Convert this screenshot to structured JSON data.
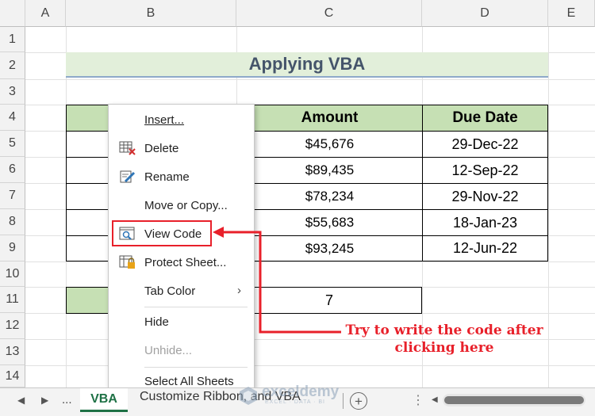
{
  "columns": [
    "A",
    "B",
    "C",
    "D",
    "E"
  ],
  "rows": [
    "1",
    "2",
    "3",
    "4",
    "5",
    "6",
    "7",
    "8",
    "9",
    "10",
    "11",
    "12",
    "13",
    "14"
  ],
  "title": "Applying VBA",
  "table": {
    "headers": [
      "",
      "Amount",
      "Due Date"
    ],
    "amounts": [
      "$45,676",
      "$89,435",
      "$78,234",
      "$55,683",
      "$93,245"
    ],
    "due_dates": [
      "29-Dec-22",
      "12-Sep-22",
      "29-Nov-22",
      "18-Jan-23",
      "12-Jun-22"
    ]
  },
  "count_value": "7",
  "context_menu": {
    "items": [
      {
        "label": "Insert...",
        "icon": "none"
      },
      {
        "label": "Delete",
        "icon": "delete-sheet-icon"
      },
      {
        "label": "Rename",
        "icon": "rename-icon"
      },
      {
        "label": "Move or Copy...",
        "icon": "none"
      },
      {
        "label": "View Code",
        "icon": "view-code-icon"
      },
      {
        "label": "Protect Sheet...",
        "icon": "protect-sheet-icon"
      },
      {
        "label": "Tab Color",
        "icon": "none"
      },
      {
        "label": "Hide",
        "icon": "none"
      },
      {
        "label": "Unhide...",
        "icon": "none",
        "disabled": true
      },
      {
        "label": "Select All Sheets",
        "icon": "none"
      }
    ]
  },
  "annotation": {
    "line1": "Try to write the code after",
    "line2": "clicking here",
    "color": "#e8202a"
  },
  "tabs": {
    "ellipsis": "...",
    "active": "VBA",
    "other": "Customize Ribbon, and VBA"
  },
  "watermark": {
    "name": "exceldemy",
    "tagline": "EXCEL · DATA · BI"
  },
  "colors": {
    "header_fill": "#c6e0b4",
    "title_fill": "#e2efda",
    "title_text": "#44546a",
    "active_tab": "#1e7145"
  }
}
